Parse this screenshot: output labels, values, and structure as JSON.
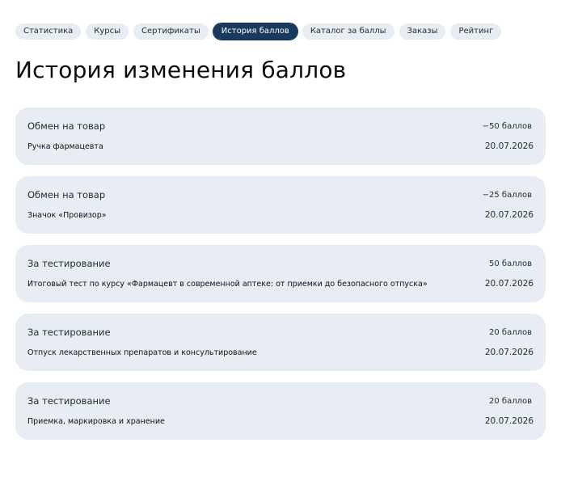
{
  "tabs": [
    {
      "label": "Статистика",
      "active": false
    },
    {
      "label": "Курсы",
      "active": false
    },
    {
      "label": "Сертификаты",
      "active": false
    },
    {
      "label": "История баллов",
      "active": true
    },
    {
      "label": "Каталог за баллы",
      "active": false
    },
    {
      "label": "Заказы",
      "active": false
    },
    {
      "label": "Рейтинг",
      "active": false
    }
  ],
  "page": {
    "title": "История изменения баллов"
  },
  "history": [
    {
      "type": "Обмен на товар",
      "points": "−50 баллов",
      "description": "Ручка фармацевта",
      "date": "20.07.2026"
    },
    {
      "type": "Обмен на товар",
      "points": "−25 баллов",
      "description": "Значок «Провизор»",
      "date": "20.07.2026"
    },
    {
      "type": "За тестирование",
      "points": "50 баллов",
      "description": "Итоговый тест по курсу «Фармацевт в современной аптеке: от приемки до безопасного отпуска»",
      "date": "20.07.2026"
    },
    {
      "type": "За тестирование",
      "points": "20 баллов",
      "description": "Отпуск лекарственных препаратов и консультирование",
      "date": "20.07.2026"
    },
    {
      "type": "За тестирование",
      "points": "20 баллов",
      "description": "Приемка, маркировка и хранение",
      "date": "20.07.2026"
    }
  ]
}
